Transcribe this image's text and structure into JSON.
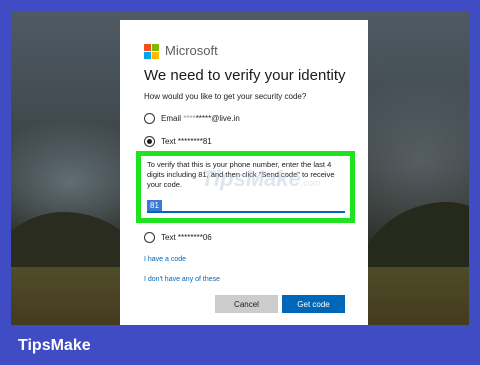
{
  "dialog": {
    "brand": "Microsoft",
    "title": "We need to verify your identity",
    "subtitle": "How would you like to get your security code?",
    "options": [
      {
        "prefix": "Email ",
        "masked": "****",
        "suffix": "*****@live.in",
        "checked": false
      },
      {
        "prefix": "Text ",
        "masked": "",
        "suffix": "********81",
        "checked": true
      },
      {
        "prefix": "Text ",
        "masked": "",
        "suffix": "********06",
        "checked": false
      }
    ],
    "instruction": "To verify that this is your phone number, enter the last 4 digits including 81, and then click \"Send code\" to receive your code.",
    "code_value": "81",
    "have_code_link": "I have a code",
    "dont_have_link": "I don't have any of these",
    "cancel_label": "Cancel",
    "get_code_label": "Get code"
  },
  "watermark": {
    "main": "TipsMake",
    "sub": ".com"
  },
  "footer": {
    "brand": "TipsMake"
  },
  "colors": {
    "frame": "#3f4cc4",
    "highlight": "#1ee31e",
    "accent": "#0067b8"
  }
}
